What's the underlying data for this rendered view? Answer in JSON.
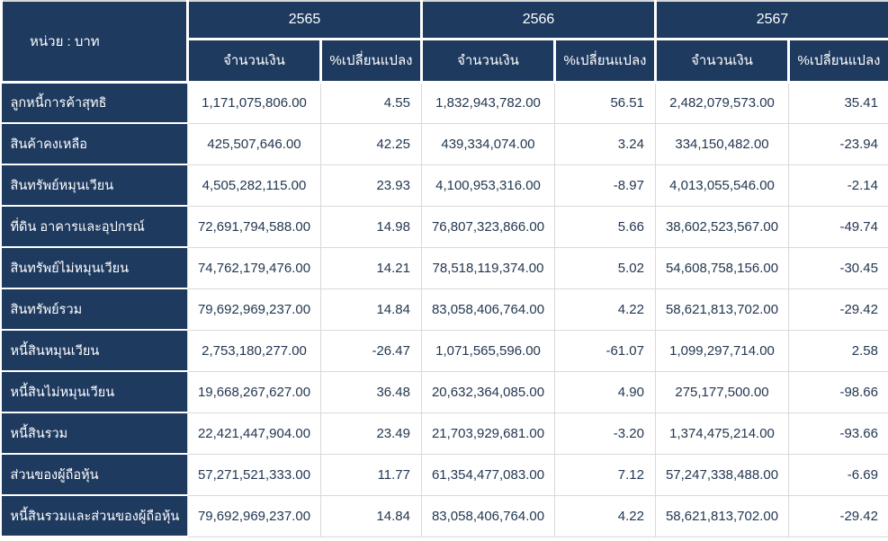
{
  "colors": {
    "header_bg": "#1e3a5f",
    "header_text": "#ffffff",
    "data_text": "#233750",
    "grid_border": "#d9d9d9"
  },
  "table": {
    "unit_label": "หน่วย : บาท",
    "years": [
      "2565",
      "2566",
      "2567"
    ],
    "sub_headers": {
      "amount": "จำนวนเงิน",
      "change": "%เปลี่ยนแปลง"
    },
    "rows": [
      {
        "label": "ลูกหนี้การค้าสุทธิ",
        "values": [
          "1,171,075,806.00",
          "4.55",
          "1,832,943,782.00",
          "56.51",
          "2,482,079,573.00",
          "35.41"
        ]
      },
      {
        "label": "สินค้าคงเหลือ",
        "values": [
          "425,507,646.00",
          "42.25",
          "439,334,074.00",
          "3.24",
          "334,150,482.00",
          "-23.94"
        ]
      },
      {
        "label": "สินทรัพย์หมุนเวียน",
        "values": [
          "4,505,282,115.00",
          "23.93",
          "4,100,953,316.00",
          "-8.97",
          "4,013,055,546.00",
          "-2.14"
        ]
      },
      {
        "label": "ที่ดิน อาคารและอุปกรณ์",
        "values": [
          "72,691,794,588.00",
          "14.98",
          "76,807,323,866.00",
          "5.66",
          "38,602,523,567.00",
          "-49.74"
        ]
      },
      {
        "label": "สินทรัพย์ไม่หมุนเวียน",
        "values": [
          "74,762,179,476.00",
          "14.21",
          "78,518,119,374.00",
          "5.02",
          "54,608,758,156.00",
          "-30.45"
        ]
      },
      {
        "label": "สินทรัพย์รวม",
        "values": [
          "79,692,969,237.00",
          "14.84",
          "83,058,406,764.00",
          "4.22",
          "58,621,813,702.00",
          "-29.42"
        ]
      },
      {
        "label": "หนี้สินหมุนเวียน",
        "values": [
          "2,753,180,277.00",
          "-26.47",
          "1,071,565,596.00",
          "-61.07",
          "1,099,297,714.00",
          "2.58"
        ]
      },
      {
        "label": "หนี้สินไม่หมุนเวียน",
        "values": [
          "19,668,267,627.00",
          "36.48",
          "20,632,364,085.00",
          "4.90",
          "275,177,500.00",
          "-98.66"
        ]
      },
      {
        "label": "หนี้สินรวม",
        "values": [
          "22,421,447,904.00",
          "23.49",
          "21,703,929,681.00",
          "-3.20",
          "1,374,475,214.00",
          "-93.66"
        ]
      },
      {
        "label": "ส่วนของผู้ถือหุ้น",
        "values": [
          "57,271,521,333.00",
          "11.77",
          "61,354,477,083.00",
          "7.12",
          "57,247,338,488.00",
          "-6.69"
        ]
      },
      {
        "label": "หนี้สินรวมและส่วนของผู้ถือหุ้น",
        "values": [
          "79,692,969,237.00",
          "14.84",
          "83,058,406,764.00",
          "4.22",
          "58,621,813,702.00",
          "-29.42"
        ]
      }
    ]
  }
}
